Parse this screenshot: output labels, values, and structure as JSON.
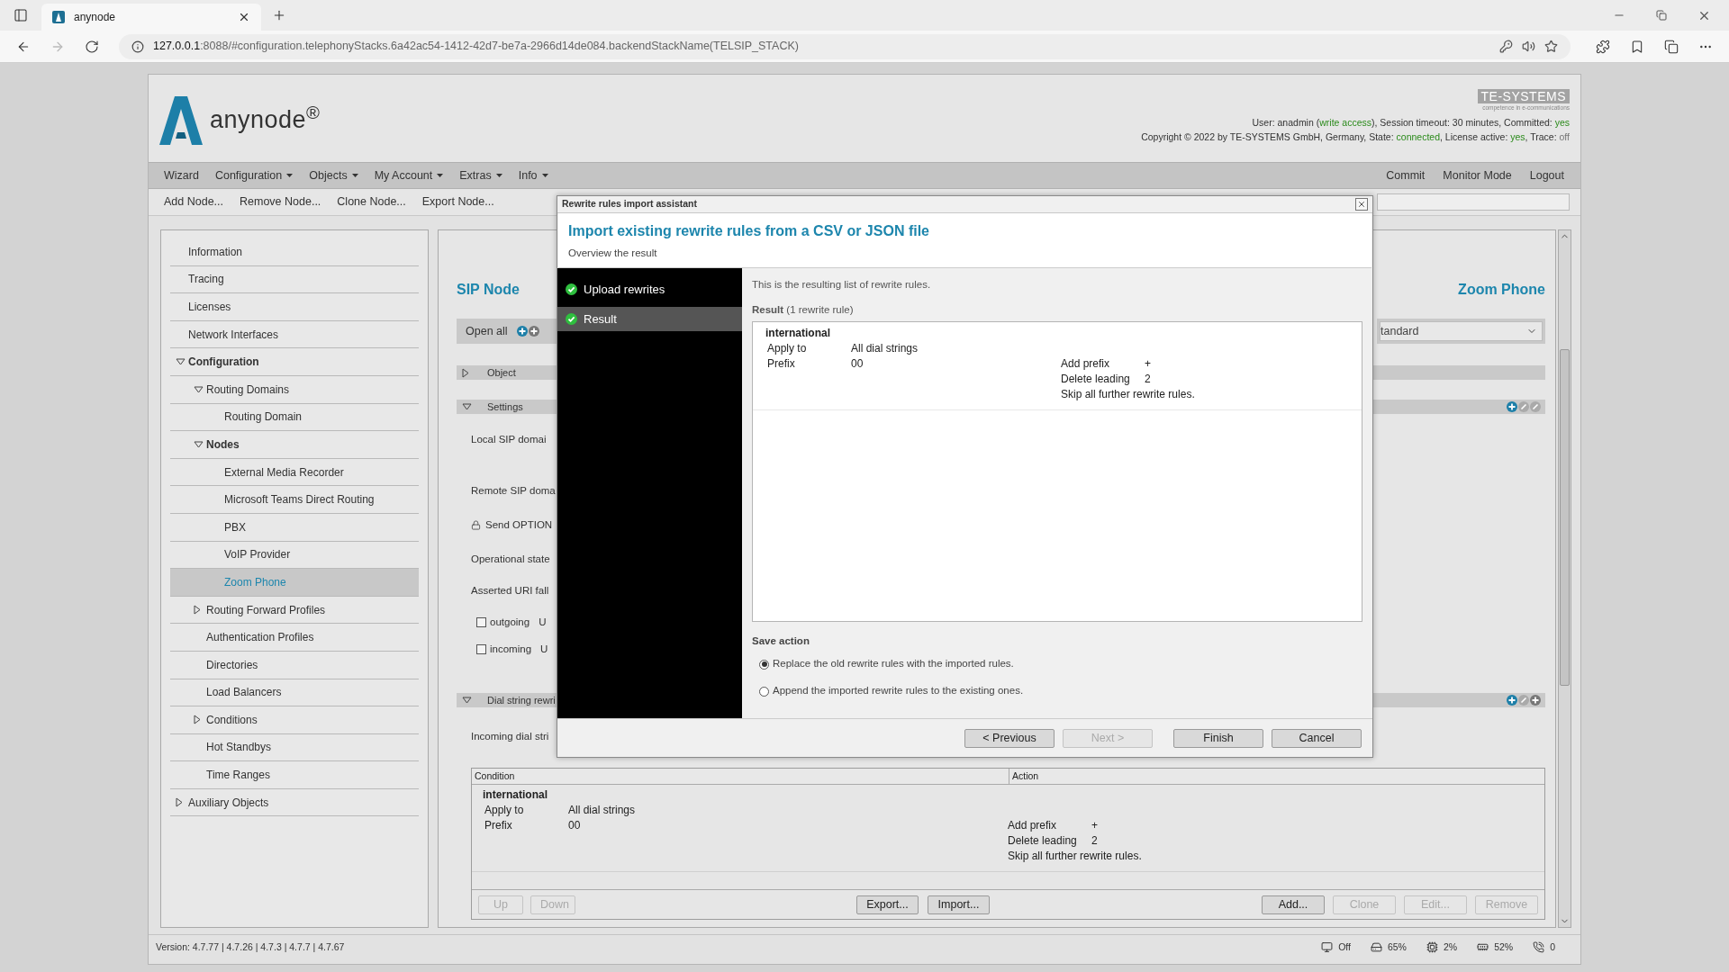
{
  "browser": {
    "tab": {
      "title": "anynode"
    },
    "address": {
      "host": "127.0.0.1",
      "rest": ":8088/#configuration.telephonyStacks.6a42ac54-1412-42d7-be7a-2966d14de084.backendStackName(TELSIP_STACK)"
    }
  },
  "header": {
    "logo": "anynode$^{®}$",
    "vendor_logo": "TE-SYSTEMS",
    "vendor_tagline": "competence in e-communications",
    "status_lines": [
      [
        {
          "kind": "label",
          "text": "User: anadmin ("
        },
        {
          "kind": "value",
          "text": "write access"
        },
        {
          "kind": "label",
          "text": "), Session timeout: 30 minutes, Committed: "
        },
        {
          "kind": "value",
          "text": "yes"
        }
      ],
      [
        {
          "kind": "label",
          "text": "Copyright © 2022 by TE-SYSTEMS GmbH, Germany, State: "
        },
        {
          "kind": "value",
          "text": "connected"
        },
        {
          "kind": "label",
          "text": ", License active: "
        },
        {
          "kind": "value",
          "text": "yes"
        },
        {
          "kind": "label",
          "text": ", Trace: "
        },
        {
          "kind": "muted",
          "text": "off"
        }
      ]
    ]
  },
  "menu": {
    "left": [
      {
        "label": "Wizard",
        "dropdown": false
      },
      {
        "label": "Configuration",
        "dropdown": true
      },
      {
        "label": "Objects",
        "dropdown": true
      },
      {
        "label": "My Account",
        "dropdown": true
      },
      {
        "label": "Extras",
        "dropdown": true
      },
      {
        "label": "Info",
        "dropdown": true
      }
    ],
    "right": [
      {
        "label": "Commit",
        "dropdown": false
      },
      {
        "label": "Monitor Mode",
        "dropdown": false
      },
      {
        "label": "Logout",
        "dropdown": false
      }
    ]
  },
  "toolbar": {
    "buttons": [
      "Add Node...",
      "Remove Node...",
      "Clone Node...",
      "Export Node..."
    ]
  },
  "sidebar": {
    "items": [
      {
        "label": "Information",
        "selected": false,
        "active_path": false
      },
      {
        "label": "Tracing",
        "selected": false,
        "active_path": false
      },
      {
        "label": "Licenses",
        "selected": false,
        "active_path": false
      },
      {
        "label": "Network Interfaces",
        "selected": false,
        "active_path": false
      },
      {
        "label": "Configuration",
        "selected": false,
        "active_path": true,
        "expanded": true,
        "children": [
          {
            "label": "Routing Domains",
            "selected": false,
            "active_path": false,
            "expanded": true,
            "children": [
              {
                "label": "Routing Domain",
                "selected": false,
                "active_path": false
              }
            ]
          },
          {
            "label": "Nodes",
            "selected": false,
            "active_path": true,
            "expanded": true,
            "children": [
              {
                "label": "External Media Recorder",
                "selected": false,
                "active_path": false
              },
              {
                "label": "Microsoft Teams Direct Routing",
                "selected": false,
                "active_path": false
              },
              {
                "label": "PBX",
                "selected": false,
                "active_path": false
              },
              {
                "label": "VoIP Provider",
                "selected": false,
                "active_path": false
              },
              {
                "label": "Zoom Phone",
                "selected": true,
                "active_path": false
              }
            ]
          },
          {
            "label": "Routing Forward Profiles",
            "selected": false,
            "active_path": false,
            "expanded": false
          },
          {
            "label": "Authentication Profiles",
            "selected": false,
            "active_path": false
          },
          {
            "label": "Directories",
            "selected": false,
            "active_path": false
          },
          {
            "label": "Load Balancers",
            "selected": false,
            "active_path": false
          },
          {
            "label": "Conditions",
            "selected": false,
            "active_path": false,
            "expanded": false
          },
          {
            "label": "Hot Standbys",
            "selected": false,
            "active_path": false
          },
          {
            "label": "Time Ranges",
            "selected": false,
            "active_path": false
          }
        ]
      },
      {
        "label": "Auxiliary Objects",
        "selected": false,
        "active_path": false,
        "expanded": false
      }
    ]
  },
  "panel": {
    "title": "SIP Node",
    "node_name": "Zoom Phone",
    "open_all": "Open all",
    "profile_select": "tandard",
    "object_section": {
      "label": "Object",
      "expanded": false
    },
    "settings_section": {
      "label": "Settings",
      "expanded": true,
      "fields": [
        {
          "kind": "label",
          "label": "Local SIP domai"
        },
        {
          "kind": "label",
          "label": "Remote SIP doma"
        },
        {
          "kind": "locked",
          "label": "Send OPTION"
        },
        {
          "kind": "label",
          "label": "Operational state"
        },
        {
          "kind": "label",
          "label": "Asserted URI fall"
        },
        {
          "kind": "checkbox",
          "label": "outgoing",
          "checked": false,
          "column_2": "U"
        },
        {
          "kind": "checkbox",
          "label": "incoming",
          "checked": false,
          "column_2": "U"
        }
      ]
    },
    "dial_section": {
      "label": "Dial string rewri",
      "expanded": true,
      "field_label": "Incoming dial stri",
      "table": {
        "columns": [
          "Condition",
          "Action"
        ],
        "rules": [
          {
            "name": "international",
            "conditions": [
              {
                "label": "Apply to",
                "value": "All dial strings"
              },
              {
                "label": "Prefix",
                "value": "00"
              }
            ],
            "actions": [
              {
                "kind": "set",
                "label": "Add prefix",
                "value": "+"
              },
              {
                "kind": "set",
                "label": "Delete leading",
                "value": "2"
              },
              {
                "kind": "flag",
                "label": "Skip all further rewrite rules."
              }
            ]
          }
        ],
        "buttons": [
          {
            "label": "Up",
            "disabled": true,
            "kind": "move"
          },
          {
            "label": "Down",
            "disabled": true,
            "kind": "move"
          },
          {
            "label": "Export...",
            "disabled": false,
            "kind": "transfer"
          },
          {
            "label": "Import...",
            "disabled": false,
            "kind": "transfer"
          },
          {
            "label": "Add...",
            "disabled": false,
            "kind": "edit"
          },
          {
            "label": "Clone",
            "disabled": true,
            "kind": "edit"
          },
          {
            "label": "Edit...",
            "disabled": true,
            "kind": "edit"
          },
          {
            "label": "Remove",
            "disabled": true,
            "kind": "edit"
          }
        ]
      }
    }
  },
  "dialog": {
    "title": "Rewrite rules import assistant",
    "heading": "Import existing rewrite rules from a CSV or JSON file",
    "subheading": "Overview the result",
    "steps": [
      {
        "label": "Upload rewrites",
        "done": true,
        "selected": false
      },
      {
        "label": "Result",
        "done": true,
        "selected": true
      }
    ],
    "intro": "This is the resulting list of rewrite rules.",
    "result_label": "**Result** (1 rewrite rule)",
    "rules": [
      {
        "name": "international",
        "conditions": [
          {
            "label": "Apply to",
            "value": "All dial strings"
          },
          {
            "label": "Prefix",
            "value": "00"
          }
        ],
        "actions": [
          {
            "kind": "set",
            "label": "Add prefix",
            "value": "+"
          },
          {
            "kind": "set",
            "label": "Delete leading",
            "value": "2"
          },
          {
            "kind": "flag",
            "label": "Skip all further rewrite rules."
          }
        ]
      }
    ],
    "save_action": {
      "label": "Save action",
      "options": [
        {
          "label": "Replace the old rewrite rules with the imported rules.",
          "selected": true
        },
        {
          "label": "Append the imported rewrite rules to the existing ones.",
          "selected": false
        }
      ]
    },
    "buttons": [
      {
        "label": "< Previous",
        "disabled": false
      },
      {
        "label": "Next >",
        "disabled": true
      },
      {
        "label": "Finish",
        "disabled": false
      },
      {
        "label": "Cancel",
        "disabled": false
      }
    ]
  },
  "status": {
    "version": "Version: 4.7.77 | 4.7.26 | 4.7.3 | 4.7.7 | 4.7.67",
    "indicators": [
      {
        "kind": "display",
        "value": "Off"
      },
      {
        "kind": "disk",
        "value": "65%"
      },
      {
        "kind": "cpu",
        "value": "2%"
      },
      {
        "kind": "memory",
        "value": "52%"
      },
      {
        "kind": "phone",
        "value": "0"
      }
    ]
  }
}
